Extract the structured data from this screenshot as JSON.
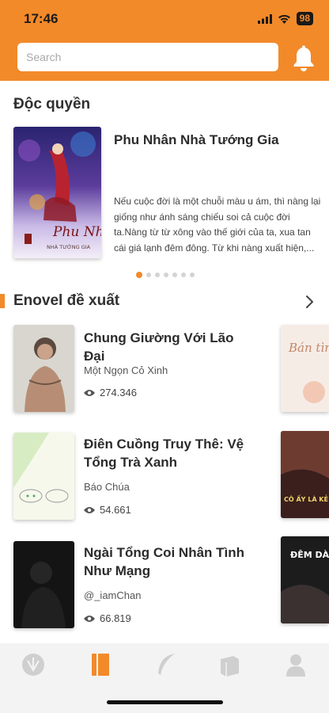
{
  "status_bar": {
    "time": "17:46",
    "battery": "98",
    "signal_icon": "signal-bars-icon",
    "wifi_icon": "wifi-icon"
  },
  "search": {
    "placeholder": "Search",
    "value": ""
  },
  "header": {
    "bell_icon": "bell-icon",
    "accent_color": "#f28a2a"
  },
  "exclusive": {
    "title": "Độc quyền",
    "featured": {
      "title": "Phu Nhân Nhà Tướng Gia",
      "description": "Nếu cuộc đời là một chuỗi màu u ám, thì nàng lại giống như ánh sáng chiếu soi cả cuộc đời ta.Nàng từ từ xông vào thế giới của ta, xua tan cái giá lạnh đêm đông. Từ khi nàng xuất hiện,...",
      "cover_text_1": "Phu Nhân",
      "cover_text_2": "NHÀ TƯỚNG GIA"
    },
    "carousel": {
      "count": 7,
      "active": 0
    }
  },
  "recommend": {
    "title": "Enovel đề xuất",
    "more_icon": "chevron-right-icon",
    "books": [
      {
        "title": "Chung Giường Với Lão Đại",
        "author": "Một Ngọn Cỏ Xinh",
        "views": "274.346"
      },
      {
        "title": "Điên Cuồng Truy Thê: Vệ Tổng Trà Xanh",
        "author": "Báo Chúa",
        "views": "54.661"
      },
      {
        "title": "Ngài Tổng Coi Nhân Tình Như Mạng",
        "author": "@_iamChan",
        "views": "66.819"
      }
    ],
    "side_covers": [
      {
        "text": "Bán tình"
      },
      {
        "text": "CÔ ẤY LÀ KẺ VÔ"
      },
      {
        "text": "ĐÊM DÀ LẮM MỘN"
      }
    ]
  },
  "tabbar": {
    "tabs": [
      {
        "icon": "home-emblem-icon",
        "active": false
      },
      {
        "icon": "bookshelf-icon",
        "active": true
      },
      {
        "icon": "feather-icon",
        "active": false
      },
      {
        "icon": "library-icon",
        "active": false
      },
      {
        "icon": "profile-icon",
        "active": false
      }
    ]
  }
}
